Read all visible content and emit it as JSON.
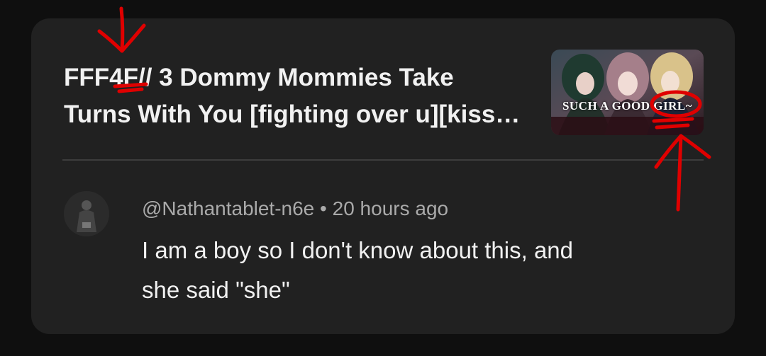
{
  "card": {
    "video_title_line1": "FFF4F// 3 Dommy Mommies Take",
    "video_title_line2": "Turns With You [fighting over u][kiss…",
    "thumbnail_text": "SUCH A GOOD GIRL~"
  },
  "comment": {
    "author": "@Nathantablet-n6e",
    "separator": "•",
    "time": "20 hours ago",
    "text_line1": "I am a boy so I don't know about this, and",
    "text_line2": "she said \"she\""
  },
  "colors": {
    "background": "#0f0f0f",
    "card": "#212121",
    "annotation": "#e00000"
  }
}
